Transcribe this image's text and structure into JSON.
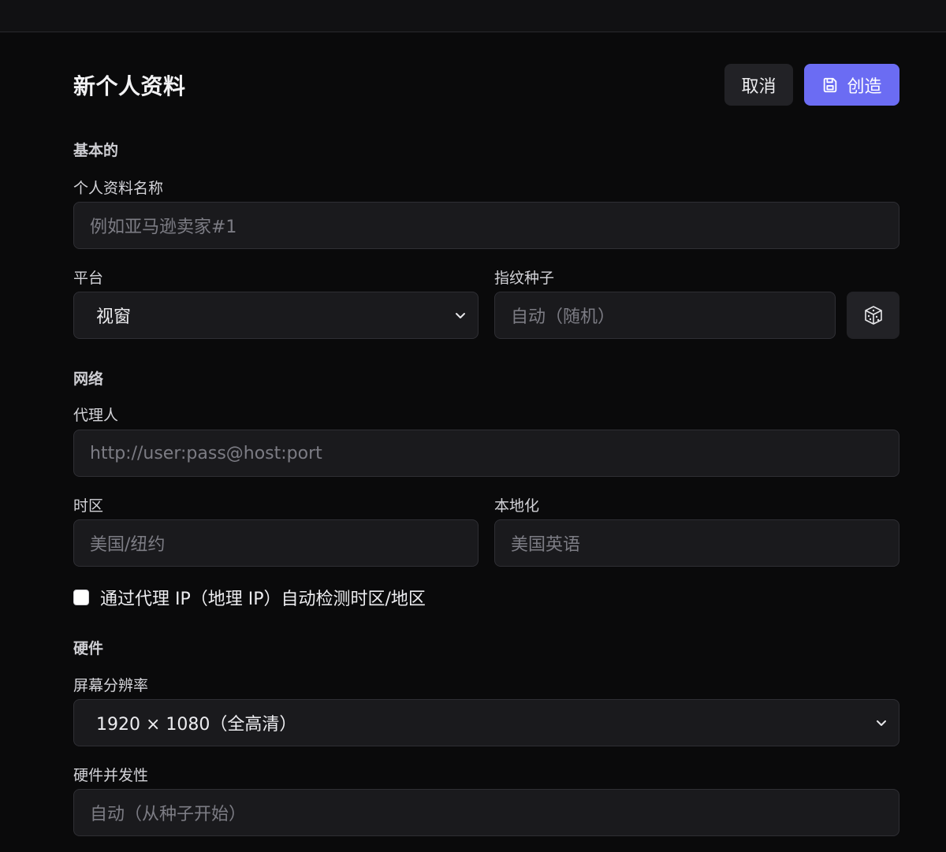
{
  "header": {
    "title": "新个人资料",
    "cancel_label": "取消",
    "create_label": "创造"
  },
  "sections": {
    "basic": "基本的",
    "network": "网络",
    "hardware": "硬件"
  },
  "basic": {
    "profile_name_label": "个人资料名称",
    "profile_name_placeholder": "例如亚马逊卖家#1",
    "platform_label": "平台",
    "platform_value": "视窗",
    "seed_label": "指纹种子",
    "seed_placeholder": "自动（随机）"
  },
  "network": {
    "proxy_label": "代理人",
    "proxy_placeholder": "http://user:pass@host:port",
    "timezone_label": "时区",
    "timezone_placeholder": "美国/纽约",
    "locale_label": "本地化",
    "locale_placeholder": "美国英语",
    "auto_detect_label": "通过代理 IP（地理 IP）自动检测时区/地区",
    "auto_detect_checked": false
  },
  "hardware": {
    "resolution_label": "屏幕分辨率",
    "resolution_value": "1920 × 1080（全高清）",
    "concurrency_label": "硬件并发性",
    "concurrency_placeholder": "自动（从种子开始）"
  },
  "colors": {
    "accent": "#6b6cf3",
    "background": "#0a0a0b",
    "field_bg": "#1a1a1d"
  },
  "icons": {
    "create": "save-icon",
    "seed": "dice-icon",
    "select": "chevron-down-icon"
  }
}
